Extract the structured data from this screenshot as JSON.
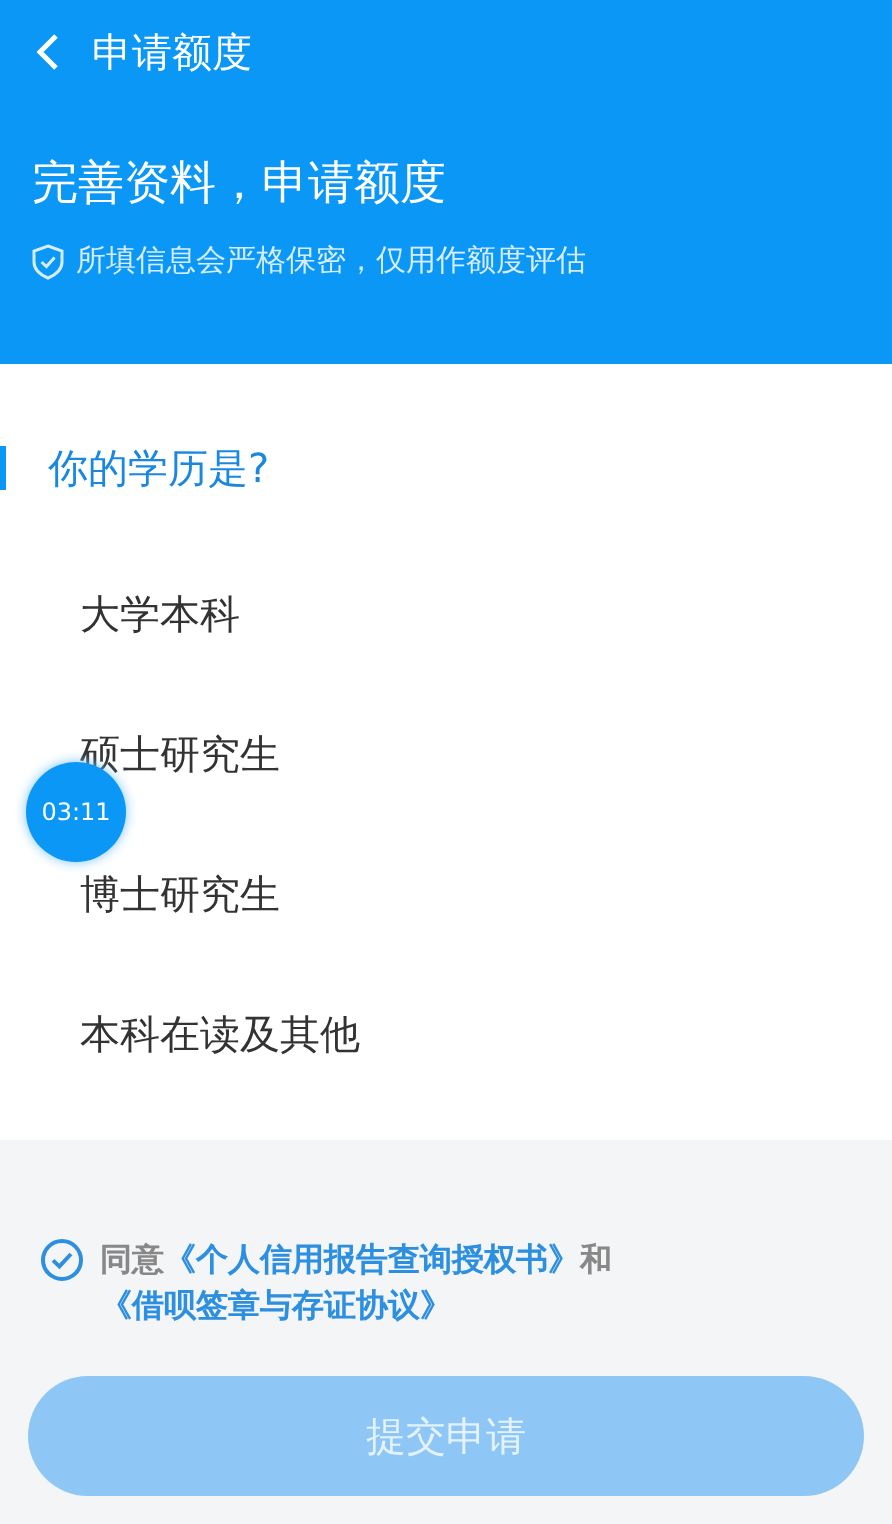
{
  "nav": {
    "title": "申请额度"
  },
  "header": {
    "heading": "完善资料，申请额度",
    "note": "所填信息会严格保密，仅用作额度评估"
  },
  "question": {
    "title": "你的学历是?",
    "options": [
      {
        "label": "大学本科",
        "selected": false
      },
      {
        "label": "硕士研究生",
        "selected": false
      },
      {
        "label": "博士研究生",
        "selected": false
      },
      {
        "label": "本科在读及其他",
        "selected": false
      }
    ]
  },
  "timer": {
    "text": "03:11"
  },
  "agreement": {
    "checked": true,
    "parts": [
      {
        "kind": "text",
        "text": "同意"
      },
      {
        "kind": "link",
        "text": "《个人信用报告查询授权书》"
      },
      {
        "kind": "text",
        "text": "和"
      },
      {
        "kind": "link",
        "text": "《借呗签章与存证协议》"
      }
    ]
  },
  "submit": {
    "label": "提交申请",
    "disabled": true
  }
}
